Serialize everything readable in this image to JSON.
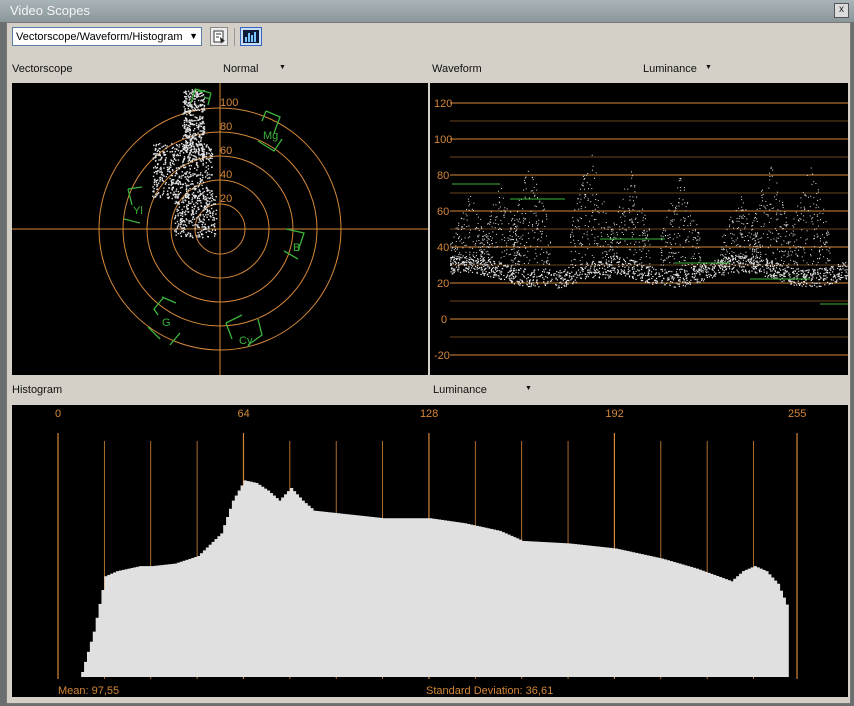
{
  "window": {
    "title": "Video Scopes",
    "close_label": "x"
  },
  "toolbar": {
    "view_select_value": "Vectorscope/Waveform/Histogram",
    "dropdown_arrow": "▼"
  },
  "vectorscope": {
    "label": "Vectorscope",
    "mode_value": "Normal",
    "ring_labels": [
      "100",
      "80",
      "60",
      "40",
      "20"
    ],
    "targets": [
      "Mg",
      "Yl",
      "B",
      "G",
      "Cy"
    ]
  },
  "waveform": {
    "label": "Waveform",
    "mode_value": "Luminance",
    "y_labels": [
      "120",
      "100",
      "80",
      "60",
      "40",
      "20",
      "0",
      "-20"
    ]
  },
  "histogram": {
    "label": "Histogram",
    "mode_value": "Luminance",
    "x_labels": [
      "0",
      "64",
      "128",
      "192",
      "255"
    ],
    "mean_text": "Mean: 97,55",
    "std_text": "Standard Deviation: 36,61"
  },
  "colors": {
    "grid_orange": "#d4873a",
    "target_green": "#3cb43c",
    "trace": "#dcdcdc",
    "scope_bg": "#000000"
  },
  "chart_data": [
    {
      "type": "histogram",
      "title": "Histogram",
      "x": [
        0,
        8,
        12,
        16,
        20,
        28,
        32,
        40,
        48,
        56,
        60,
        64,
        68,
        72,
        76,
        80,
        84,
        88,
        96,
        104,
        112,
        128,
        140,
        152,
        160,
        176,
        192,
        208,
        220,
        232,
        236,
        240,
        244,
        248,
        252,
        255
      ],
      "values": [
        0,
        2,
        18,
        40,
        42,
        44,
        44,
        45,
        48,
        57,
        70,
        78,
        77,
        74,
        70,
        75,
        70,
        66,
        65,
        64,
        63,
        63,
        61,
        58,
        54,
        53,
        51,
        47,
        43,
        38,
        42,
        44,
        42,
        37,
        26,
        0
      ],
      "xlim": [
        0,
        255
      ],
      "x_ticks": [
        0,
        64,
        128,
        192,
        255
      ]
    },
    {
      "type": "scatter",
      "title": "Waveform",
      "ylim": [
        -20,
        120
      ],
      "y_ticks": [
        120,
        100,
        80,
        60,
        40,
        20,
        0,
        -20
      ],
      "grid": true
    }
  ]
}
